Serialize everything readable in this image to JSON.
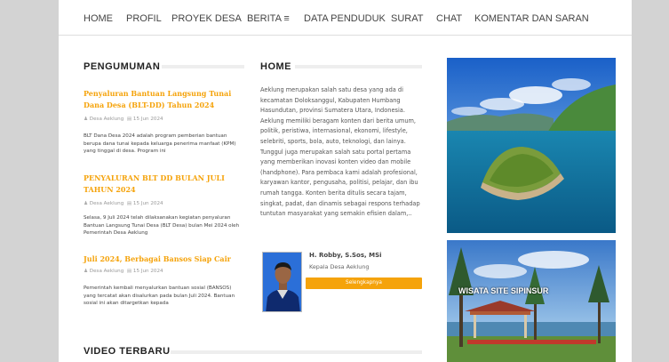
{
  "nav": {
    "items": [
      "HOME",
      "PROFIL",
      "PROYEK DESA",
      "BERITA ≡",
      "DATA PENDUDUK",
      "SURAT",
      "CHAT",
      "KOMENTAR DAN SARAN"
    ]
  },
  "pengumuman": {
    "title": "PENGUMUMAN",
    "posts": [
      {
        "title": "Penyaluran Bantuan Langsung Tunai Dana Desa (BLT-DD) Tahun 2024",
        "author": "Desa Aeklung",
        "date": "15 Jun 2024",
        "excerpt": "BLT Dana Desa 2024 adalah program pemberian bantuan berupa dana tunai kepada keluarga penerima manfaat (KPM) yang tinggal di desa. Program ini"
      },
      {
        "title": "PENYALURAN BLT DD BULAN JULI TAHUN 2024",
        "author": "Desa Aeklung",
        "date": "15 Jun 2024",
        "excerpt": "Selasa, 9 Juli 2024 telah dilaksanakan kegiatan penyaluran Bantuan Langsung Tunai Desa (BLT Desa) bulan Mei 2024 oleh Pemerintah Desa Aeklung"
      },
      {
        "title": "Juli 2024, Berbagai Bansos Siap Cair",
        "author": "Desa Aeklung",
        "date": "15 Jun 2024",
        "excerpt": "Pemerintah kembali menyalurkan bantuan sosial (BANSOS) yang tercatat akan disalurkan pada bulan Juli 2024. Bantuan sosial ini akan ditargetkan kepada"
      }
    ]
  },
  "home": {
    "title": "HOME",
    "text": "Aeklung merupakan salah satu desa yang ada di kecamatan Doloksanggul, Kabupaten Humbang Hasundutan, provinsi Sumatera Utara, Indonesia. Aeklung memiliki beragam konten dari berita umum, politik, peristiwa, internasional, ekonomi, lifestyle, selebriti, sports, bola, auto, teknologi, dan lainya. Tunggul juga merupakan salah satu portal pertama yang memberikan inovasi konten video dan mobile (handphone). Para pembaca kami adalah profesional, karyawan kantor, pengusaha, politisi, pelajar, dan ibu rumah tangga. Konten berita ditulis secara tajam, singkat, padat, dan dinamis sebagai respons terhadap tuntutan masyarakat yang semakin efisien dalam,..",
    "head_name": "H. Robby, S.Sos, MSi",
    "head_role": "Kepala Desa Aeklung",
    "more_label": "Selengkapnya"
  },
  "video": {
    "title": "VIDEO TERBARU"
  },
  "photos": {
    "second_sign": "WISATA SITE SIPINSUR"
  },
  "colors": {
    "accent": "#f5a30b",
    "page": "#ffffff",
    "backdrop": "#d3d3d3"
  }
}
